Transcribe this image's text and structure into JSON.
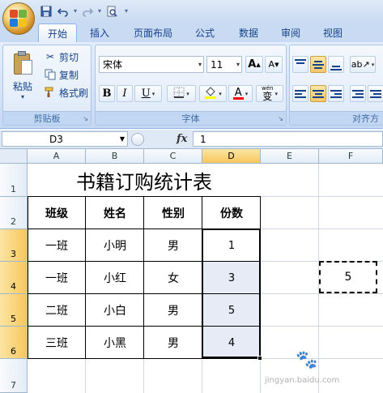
{
  "quick_access": {
    "icons": [
      "save-icon",
      "undo-icon",
      "redo-icon",
      "print-preview-icon",
      "customize-icon"
    ]
  },
  "tabs": [
    "开始",
    "插入",
    "页面布局",
    "公式",
    "数据",
    "审阅",
    "视图"
  ],
  "active_tab": "开始",
  "clipboard": {
    "paste_label": "粘贴",
    "cut_label": "剪切",
    "copy_label": "复制",
    "format_painter_label": "格式刷",
    "group_label": "剪贴板"
  },
  "font": {
    "name": "宋体",
    "size": "11",
    "grow_label": "A",
    "shrink_label": "A",
    "bold_label": "B",
    "italic_label": "I",
    "underline_label": "U",
    "font_color_label": "A",
    "phonetic_label": "wén",
    "phonetic_char": "变",
    "group_label": "字体",
    "font_color": "#ff0000",
    "fill_color": "#ffff00"
  },
  "alignment": {
    "group_label": "对齐方"
  },
  "formula_bar": {
    "name_box": "D3",
    "fx_label": "fx",
    "formula": "1"
  },
  "grid": {
    "columns": [
      "A",
      "B",
      "C",
      "D",
      "E",
      "F"
    ],
    "selected_column": "D",
    "rows": [
      "1",
      "2",
      "3",
      "4",
      "5",
      "6",
      "7"
    ],
    "selected_rows": [
      "3",
      "4",
      "5",
      "6"
    ]
  },
  "sheet": {
    "title": "书籍订购统计表",
    "headers": [
      "班级",
      "姓名",
      "性别",
      "份数"
    ],
    "rows": [
      [
        "一班",
        "小明",
        "男",
        "1"
      ],
      [
        "一班",
        "小红",
        "女",
        "3"
      ],
      [
        "二班",
        "小白",
        "男",
        "5"
      ],
      [
        "三班",
        "小黑",
        "男",
        "4"
      ]
    ],
    "copied_cell_value": "5"
  },
  "watermark": {
    "text": "jingyan.baidu.com"
  }
}
